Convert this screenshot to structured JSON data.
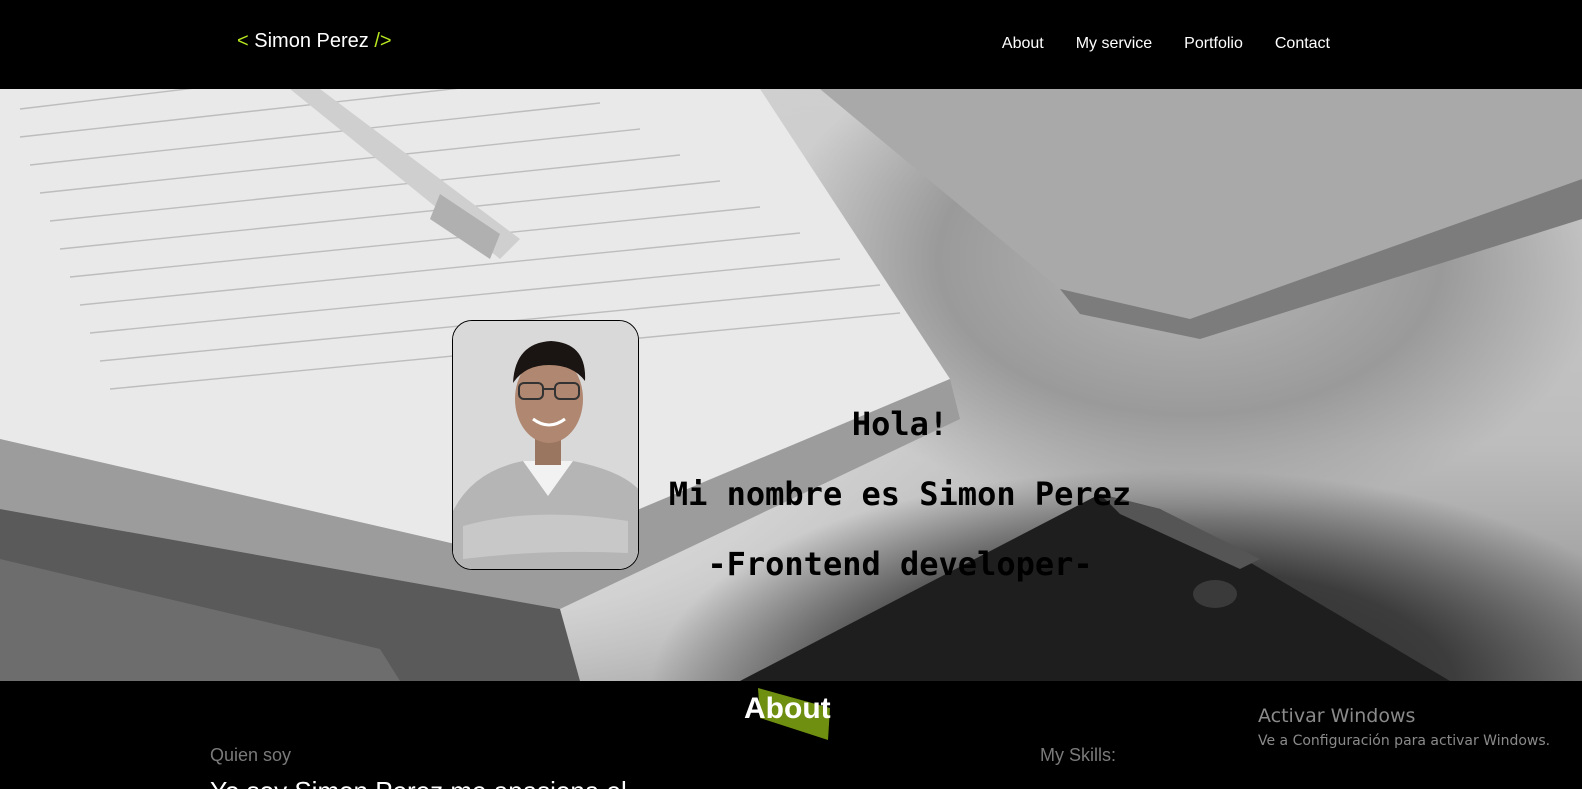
{
  "header": {
    "logo_open": "<",
    "logo_name": "Simon Perez",
    "logo_close": "/>",
    "nav": [
      "About",
      "My service",
      "Portfolio",
      "Contact"
    ]
  },
  "hero": {
    "greeting": "Hola!",
    "name_line": "Mi nombre es Simon Perez",
    "role_line": "-Frontend developer-"
  },
  "about": {
    "title": "About",
    "who_label": "Quien soy",
    "skills_label": "My Skills:",
    "intro_partial": "Yo soy Simon Perez me apasiona el"
  },
  "watermark": {
    "title": "Activar Windows",
    "subtitle": "Ve a Configuración para activar Windows."
  },
  "colors": {
    "accent": "#b7e61f",
    "accent_dark": "#6f8f10",
    "background": "#000000",
    "text": "#ffffff"
  }
}
